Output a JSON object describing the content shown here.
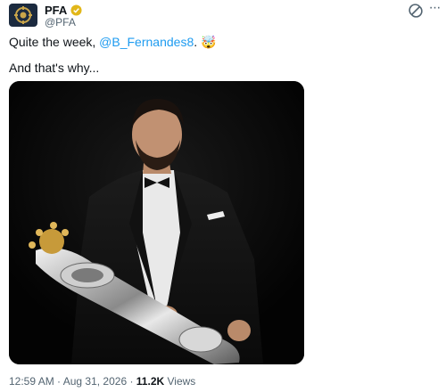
{
  "author": {
    "name": "PFA",
    "handle": "@PFA"
  },
  "tweet": {
    "text_before": "Quite the week, ",
    "mention": "@B_Fernandes8",
    "text_after": ". 🤯",
    "line2": "And that's why..."
  },
  "meta": {
    "time": "12:59 AM",
    "separator": " · ",
    "date": "Aug 31, 2026",
    "views_count": "11.2K",
    "views_label": " Views"
  },
  "colors": {
    "accent": "#1d9bf0",
    "verified": "#e2b719",
    "avatar_bg": "#1b2a3f"
  },
  "icons": {
    "avatar": "pfa-logo-icon",
    "verified": "verified-badge-icon",
    "grok": "grok-icon",
    "more": "more-icon"
  }
}
